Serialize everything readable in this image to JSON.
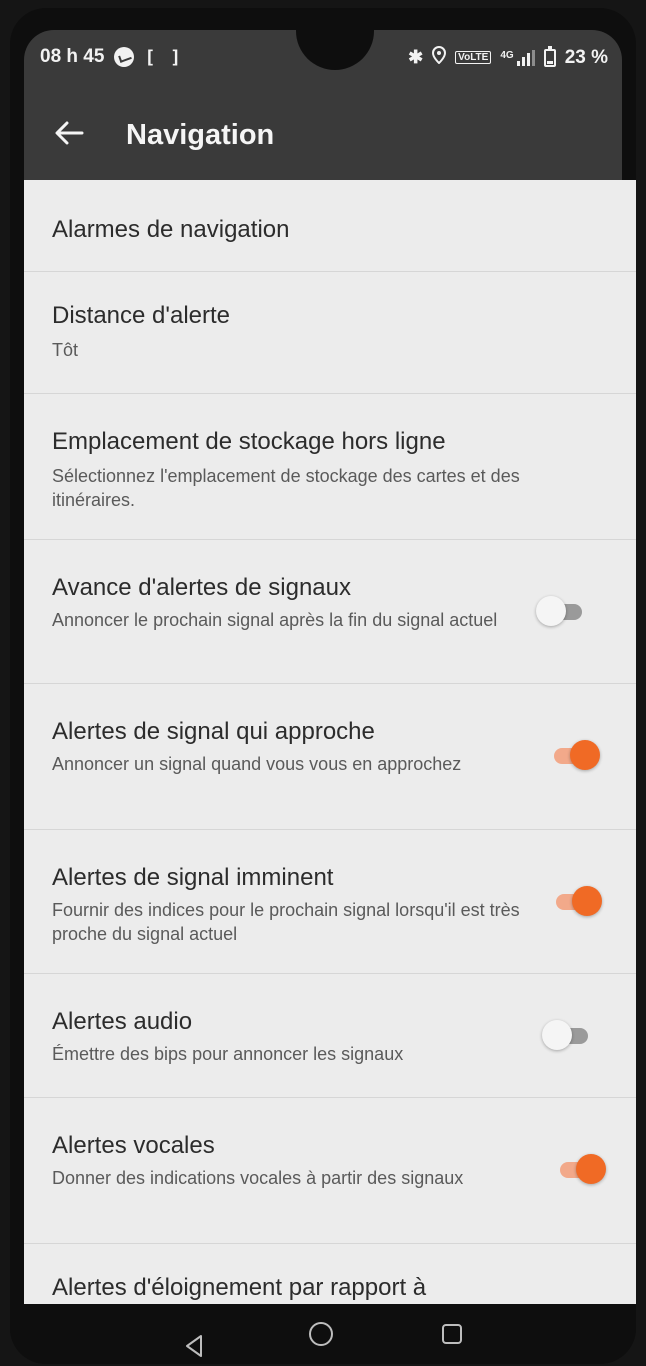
{
  "status": {
    "time": "08 h 45",
    "screenshot_glyph": "[ ]",
    "volte": "VoLTE",
    "network": "4G",
    "battery": "23 %",
    "icons": [
      "messenger-icon",
      "screenshot-icon",
      "bluetooth-icon",
      "location-icon",
      "volte-icon",
      "signal-icon",
      "battery-icon"
    ]
  },
  "app_bar": {
    "back_icon": "arrow-left-icon",
    "title": "Navigation"
  },
  "settings": [
    {
      "title": "Alarmes de navigation"
    },
    {
      "title": "Distance d'alerte",
      "summary": "Tôt"
    },
    {
      "title": "Emplacement de stockage hors ligne",
      "summary": "Sélectionnez l'emplacement de stockage des cartes et des itinéraires."
    },
    {
      "title": "Avance d'alertes de signaux",
      "summary": "Annoncer le prochain signal après la fin du signal actuel",
      "enabled": false
    },
    {
      "title": "Alertes de signal qui approche",
      "summary": "Annoncer un signal quand vous vous en approchez",
      "enabled": true
    },
    {
      "title": "Alertes de signal imminent",
      "summary": "Fournir des indices pour le prochain signal lorsqu'il est très proche du signal actuel",
      "enabled": true
    },
    {
      "title": "Alertes audio",
      "summary": "Émettre des bips pour annoncer les signaux",
      "enabled": false
    },
    {
      "title": "Alertes vocales",
      "summary": "Donner des indications vocales à partir des signaux",
      "enabled": true
    },
    {
      "title": "Alertes d'éloignement par rapport à"
    }
  ],
  "colors": {
    "accent": "#f06a25",
    "accent_track": "#f2a98a",
    "app_bar": "#3a3a3a",
    "background": "#ececec"
  },
  "nav_bar": {
    "icons": [
      "back-triangle-icon",
      "home-circle-icon",
      "recents-square-icon"
    ]
  }
}
